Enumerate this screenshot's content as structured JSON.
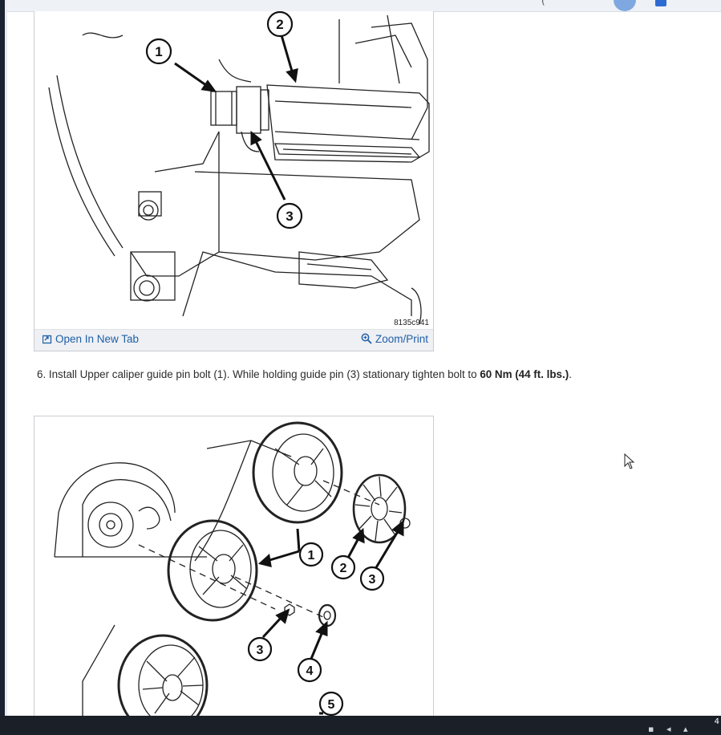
{
  "figure1": {
    "image_code": "8135c941",
    "callouts": [
      "1",
      "2",
      "3"
    ],
    "open_tab_label": "Open In New Tab",
    "zoom_label": "Zoom/Print"
  },
  "step6": {
    "prefix": "6. Install Upper caliper guide pin bolt (1). While holding guide pin (3) stationary tighten bolt to ",
    "torque": "60 Nm (44 ft. lbs.)",
    "suffix": "."
  },
  "figure2": {
    "callouts": [
      "1",
      "2",
      "3",
      "3",
      "4",
      "5"
    ]
  },
  "topbar": {
    "paren": "("
  },
  "taskbar": {
    "clock_fragment": "4"
  },
  "colors": {
    "link": "#1f5fa8",
    "taskbar": "#1a1f28"
  },
  "icons": [
    "open-new-tab-icon",
    "zoom-icon",
    "mouse-cursor-icon"
  ]
}
